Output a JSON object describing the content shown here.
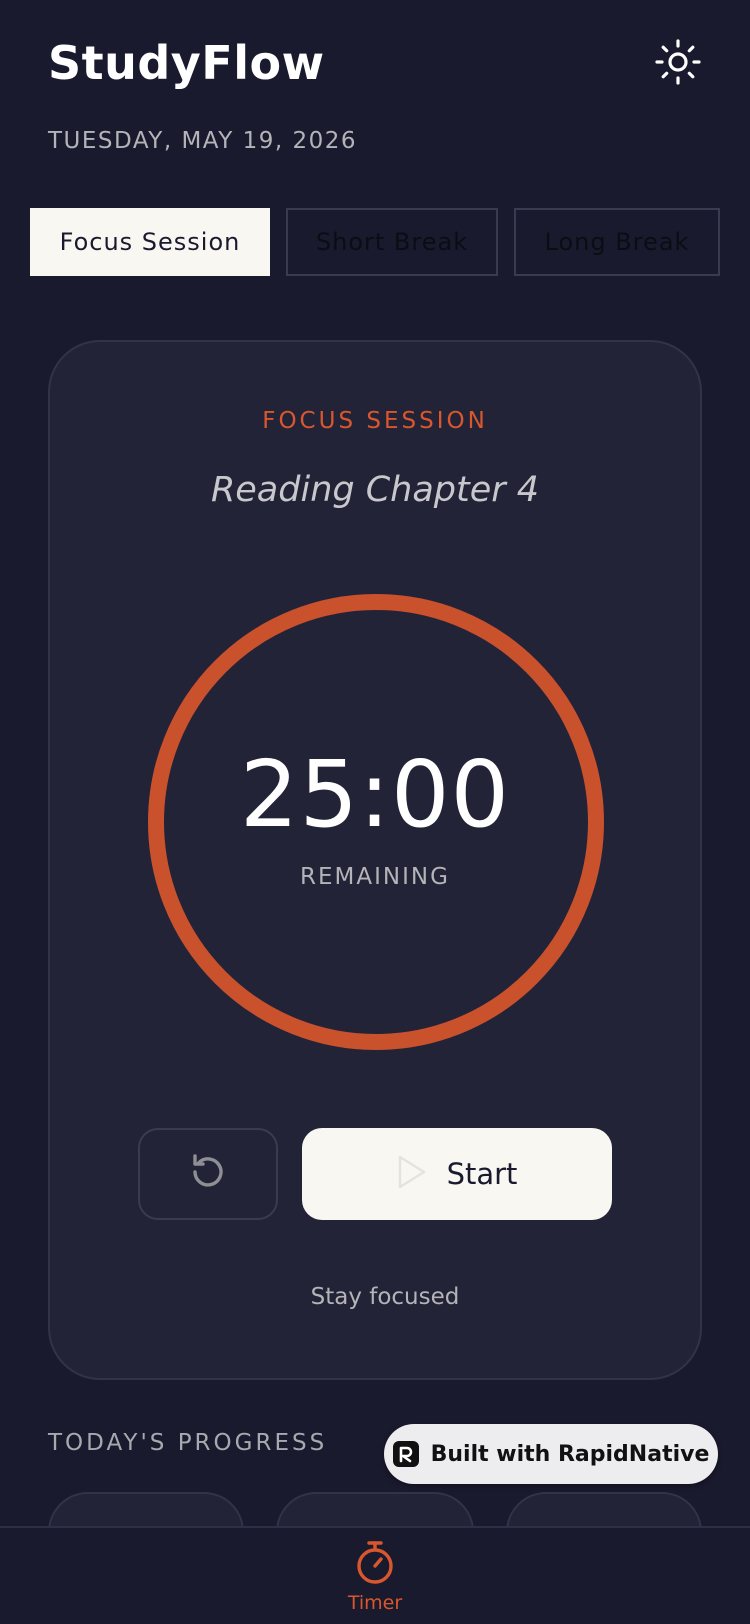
{
  "app": {
    "title": "StudyFlow",
    "date": "TUESDAY, MAY 19, 2026"
  },
  "icons": {
    "theme": "sun-icon",
    "reset": "rotate-ccw-icon",
    "start": "play-icon",
    "nav_timer": "timer-icon",
    "badge": "rapidnative-logo-icon"
  },
  "colors": {
    "accent": "#d9572d",
    "ring": "#c9512c",
    "background": "#1a1a2e",
    "card": "#232338",
    "light": "#f8f7f2"
  },
  "modes": {
    "focus": "Focus Session",
    "short": "Short Break",
    "long": "Long Break",
    "selected": "Focus Session"
  },
  "timer": {
    "session_type": "FOCUS SESSION",
    "task": "Reading Chapter 4",
    "time": "25:00",
    "sub_label": "REMAINING",
    "progress": 1.0,
    "start_label": "Start",
    "message": "Stay focused"
  },
  "progress": {
    "title": "TODAY'S PROGRESS"
  },
  "badge": {
    "label": "Built with RapidNative"
  },
  "nav": {
    "timer_label": "Timer"
  }
}
